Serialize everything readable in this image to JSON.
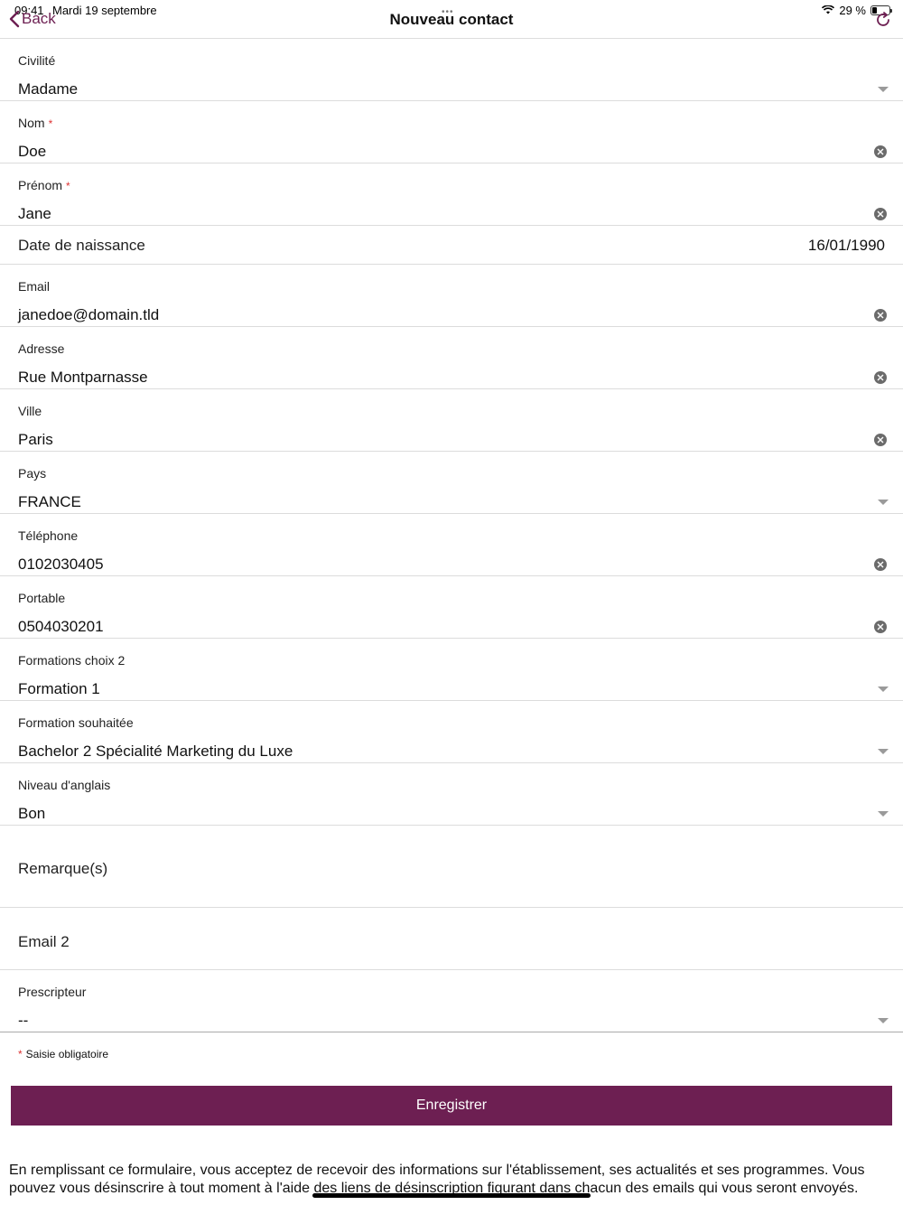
{
  "status": {
    "time": "09:41",
    "date": "Mardi 19 septembre",
    "battery": "29 %",
    "battery_level": 0.29
  },
  "nav": {
    "back_label": "Back",
    "title": "Nouveau contact"
  },
  "fields": {
    "civilite": {
      "label": "Civilité",
      "value": "Madame"
    },
    "nom": {
      "label": "Nom",
      "required": "*",
      "value": "Doe"
    },
    "prenom": {
      "label": "Prénom",
      "required": "*",
      "value": "Jane"
    },
    "naissance": {
      "label": "Date de naissance",
      "value": "16/01/1990"
    },
    "email": {
      "label": "Email",
      "value": "janedoe@domain.tld"
    },
    "adresse": {
      "label": "Adresse",
      "value": "Rue Montparnasse"
    },
    "ville": {
      "label": "Ville",
      "value": "Paris"
    },
    "pays": {
      "label": "Pays",
      "value": "FRANCE"
    },
    "telephone": {
      "label": "Téléphone",
      "value": "0102030405"
    },
    "portable": {
      "label": "Portable",
      "value": "0504030201"
    },
    "formations_choix2": {
      "label": "Formations choix 2",
      "value": "Formation 1"
    },
    "formation_souhaitee": {
      "label": "Formation souhaitée",
      "value": "Bachelor 2 Spécialité Marketing du Luxe"
    },
    "niveau_anglais": {
      "label": "Niveau d'anglais",
      "value": "Bon"
    },
    "remarques": {
      "label": "Remarque(s)",
      "value": ""
    },
    "email2": {
      "label": "Email 2",
      "value": ""
    },
    "prescripteur": {
      "label": "Prescripteur",
      "value": "--"
    }
  },
  "mandatory_note": {
    "star": "*",
    "text": "Saisie obligatoire"
  },
  "save_label": "Enregistrer",
  "disclaimer": "En remplissant ce formulaire, vous acceptez de recevoir des informations sur l'établissement, ses actualités et ses programmes. Vous pouvez vous désinscrire à tout moment à l'aide des liens de désinscription figurant dans chacun des emails qui vous seront envoyés.",
  "colors": {
    "accent": "#6d1f52",
    "required": "#dd3333"
  },
  "icons": [
    "chevron-left-icon",
    "refresh-icon",
    "clear-icon",
    "dropdown-caret-icon",
    "wifi-icon",
    "battery-icon"
  ]
}
